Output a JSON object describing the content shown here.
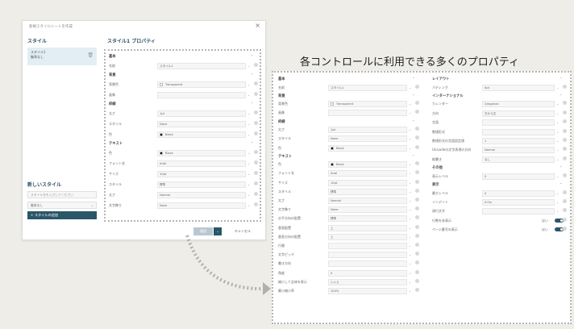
{
  "dialog": {
    "title": "新規スタイルシートを作成",
    "styles_heading": "スタイル",
    "style_item_line1": "スタイル1",
    "style_item_line2": "継承なし",
    "new_style_heading": "新しいスタイル",
    "new_style_name_placeholder": "スタイル名を入力してください",
    "new_style_inherit_value": "継承なし",
    "add_style_button": "+ スタイルの追加",
    "props_heading": "スタイル1 プロパティ",
    "ok_button": "適用",
    "cancel_button": "キャンセル"
  },
  "dialog_props": {
    "groups": [
      {
        "title": "基本",
        "rows": [
          {
            "label": "名前",
            "value": "スタイル1"
          }
        ]
      },
      {
        "title": "背景",
        "rows": [
          {
            "label": "背景色",
            "value": "Transparent",
            "swatch": "#ffffff"
          },
          {
            "label": "画像",
            "value": ""
          }
        ]
      },
      {
        "title": "枠線",
        "rows": [
          {
            "label": "太さ",
            "value": "1pt"
          },
          {
            "label": "スタイル",
            "value": "None"
          },
          {
            "label": "色",
            "value": "Black",
            "swatch": "#000000"
          }
        ]
      },
      {
        "title": "テキスト",
        "rows": [
          {
            "label": "色",
            "value": "Black",
            "swatch": "#000000"
          },
          {
            "label": "フォント名",
            "value": "Arial"
          },
          {
            "label": "サイズ",
            "value": "10pt"
          },
          {
            "label": "スタイル",
            "value": "標準"
          },
          {
            "label": "太さ",
            "value": "Normal"
          },
          {
            "label": "文字飾り",
            "value": "None"
          }
        ]
      }
    ]
  },
  "headline": "各コントロールに利用できる多くのプロパティ",
  "left_props": [
    {
      "type": "group",
      "label": "基本"
    },
    {
      "type": "row",
      "label": "名前",
      "value": "スタイル1"
    },
    {
      "type": "group",
      "label": "背景"
    },
    {
      "type": "row",
      "label": "背景色",
      "value": "Transparent",
      "swatch": "#ffffff"
    },
    {
      "type": "row",
      "label": "画像",
      "value": ""
    },
    {
      "type": "group",
      "label": "枠線"
    },
    {
      "type": "row",
      "label": "太さ",
      "value": "1pt"
    },
    {
      "type": "row",
      "label": "スタイル",
      "value": "None"
    },
    {
      "type": "row",
      "label": "色",
      "value": "Black",
      "swatch": "#000000"
    },
    {
      "type": "group",
      "label": "テキスト"
    },
    {
      "type": "row",
      "label": "色",
      "value": "Black",
      "swatch": "#000000"
    },
    {
      "type": "row",
      "label": "フォント名",
      "value": "Arial"
    },
    {
      "type": "row",
      "label": "サイズ",
      "value": "10pt"
    },
    {
      "type": "row",
      "label": "スタイル",
      "value": "標準"
    },
    {
      "type": "row",
      "label": "太さ",
      "value": "Normal"
    },
    {
      "type": "row",
      "label": "文字飾り",
      "value": "None"
    },
    {
      "type": "row",
      "label": "水平方向の配置",
      "value": "標準"
    },
    {
      "type": "row",
      "label": "垂直配置",
      "value": "上"
    },
    {
      "type": "row",
      "label": "垂直方向の配置",
      "value": "上"
    },
    {
      "type": "row",
      "label": "行間",
      "value": ""
    },
    {
      "type": "row",
      "label": "文字ピッチ",
      "value": ""
    },
    {
      "type": "row",
      "label": "書き方向",
      "value": ""
    },
    {
      "type": "row",
      "label": "角度",
      "value": "0"
    },
    {
      "type": "row",
      "label": "縮小して全体を表示",
      "value": "いいえ"
    },
    {
      "type": "row",
      "label": "最小縮小率",
      "value": "100%"
    }
  ],
  "right_props": [
    {
      "type": "group",
      "label": "レイアウト"
    },
    {
      "type": "row",
      "label": "パディング",
      "value": "0pt"
    },
    {
      "type": "group",
      "label": "インターナショナル"
    },
    {
      "type": "row",
      "label": "カレンダー",
      "value": "Gregorian"
    },
    {
      "type": "row",
      "label": "方向",
      "value": "左から右"
    },
    {
      "type": "row",
      "label": "言語",
      "value": ""
    },
    {
      "type": "row",
      "label": "数値形式",
      "value": ""
    },
    {
      "type": "row",
      "label": "数値形式の言語設定値",
      "value": "1"
    },
    {
      "type": "row",
      "label": "Unicodeの文字表現の方向",
      "value": "Normal"
    },
    {
      "type": "row",
      "label": "縦書き",
      "value": "なし"
    },
    {
      "type": "group",
      "label": "その他"
    },
    {
      "type": "row",
      "label": "表示レベル",
      "value": "0"
    },
    {
      "type": "group",
      "label": "表示"
    },
    {
      "type": "row",
      "label": "最大レベル",
      "value": "0"
    },
    {
      "type": "row",
      "label": "インデント",
      "value": "0.0in"
    },
    {
      "type": "row",
      "label": "改行文字",
      "value": ""
    },
    {
      "type": "row",
      "label": "行数を非表示",
      "value": "はい",
      "toggle": true
    },
    {
      "type": "row",
      "label": "ページ番号の表示",
      "value": "はい",
      "toggle": true
    }
  ]
}
